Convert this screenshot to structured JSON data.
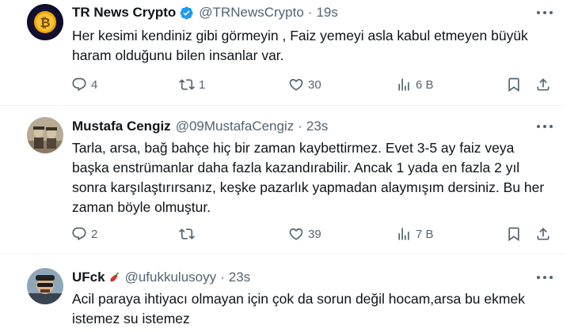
{
  "tweets": [
    {
      "name": "TR News Crypto",
      "handle": "@TRNewsCrypto",
      "dot": "·",
      "time": "19s",
      "text": "Her kesimi kendiniz gibi görmeyin , Faiz yemeyi asla kabul etmeyen büyük haram olduğunu bilen insanlar var.",
      "replies": "4",
      "retweets": "1",
      "likes": "30",
      "views": "6 B"
    },
    {
      "name": "Mustafa Cengiz",
      "handle": "@09MustafaCengiz",
      "dot": "·",
      "time": "23s",
      "text": "Tarla, arsa, bağ bahçe hiç bir zaman kaybettirmez. Evet 3-5 ay faiz veya başka enstrümanlar daha fazla kazandırabilir. Ancak 1 yada en fazla 2 yıl sonra karşılaştırırsanız, keşke pazarlık yapmadan alaymışım dersiniz. Bu her zaman böyle olmuştur.",
      "replies": "2",
      "retweets": "",
      "likes": "39",
      "views": "7 B"
    },
    {
      "name": "UFck",
      "handle": "@ufukkulusoyy",
      "dot": "·",
      "time": "23s",
      "text": "Acil paraya ihtiyacı olmayan için çok da sorun değil hocam,arsa bu ekmek istemez su istemez"
    }
  ],
  "icons": {
    "reply": "reply-icon",
    "retweet": "retweet-icon",
    "like": "heart-icon",
    "views": "views-icon",
    "bookmark": "bookmark-icon",
    "share": "share-icon",
    "more": "more-icon",
    "verified": "verified-badge-icon",
    "chili": "chili-pepper-emoji"
  },
  "colors": {
    "text": "#0f1419",
    "muted": "#536471",
    "verified": "#1d9bf0",
    "divider": "#eff3f4"
  }
}
